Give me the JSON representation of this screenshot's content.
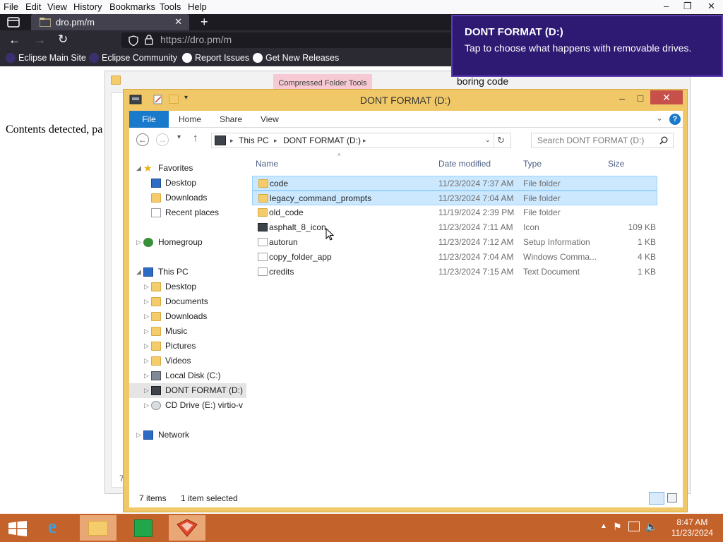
{
  "browser": {
    "menu": [
      "File",
      "Edit",
      "View",
      "History",
      "Bookmarks",
      "Tools",
      "Help"
    ],
    "tab_title": "dro.pm/m",
    "url": "https://dro.pm/m",
    "bookmarks": [
      "Eclipse Main Site",
      "Eclipse Community",
      "Report Issues",
      "Get New Releases"
    ]
  },
  "page": {
    "text": "Contents detected, pa"
  },
  "background_window": {
    "tools_tab": "Compressed Folder Tools",
    "title": "boring code",
    "left_label": "7"
  },
  "toast": {
    "title": "DONT FORMAT (D:)",
    "message": "Tap to choose what happens with removable drives."
  },
  "explorer": {
    "title": "DONT FORMAT (D:)",
    "ribbon_tabs": [
      "File",
      "Home",
      "Share",
      "View"
    ],
    "breadcrumb": [
      "This PC",
      "DONT FORMAT (D:)"
    ],
    "search_placeholder": "Search DONT FORMAT (D:)",
    "columns": [
      "Name",
      "Date modified",
      "Type",
      "Size"
    ],
    "nav": {
      "favorites": "Favorites",
      "favorites_items": [
        "Desktop",
        "Downloads",
        "Recent places"
      ],
      "homegroup": "Homegroup",
      "thispc": "This PC",
      "thispc_items": [
        "Desktop",
        "Documents",
        "Downloads",
        "Music",
        "Pictures",
        "Videos",
        "Local Disk (C:)",
        "DONT FORMAT (D:)",
        "CD Drive (E:) virtio-v"
      ],
      "network": "Network"
    },
    "files": [
      {
        "name": "code",
        "date": "11/23/2024 7:37 AM",
        "type": "File folder",
        "size": ""
      },
      {
        "name": "legacy_command_prompts",
        "date": "11/23/2024 7:04 AM",
        "type": "File folder",
        "size": ""
      },
      {
        "name": "old_code",
        "date": "11/19/2024 2:39 PM",
        "type": "File folder",
        "size": ""
      },
      {
        "name": "asphalt_8_icon",
        "date": "11/23/2024 7:11 AM",
        "type": "Icon",
        "size": "109 KB"
      },
      {
        "name": "autorun",
        "date": "11/23/2024 7:12 AM",
        "type": "Setup Information",
        "size": "1 KB"
      },
      {
        "name": "copy_folder_app",
        "date": "11/23/2024 7:04 AM",
        "type": "Windows Comma...",
        "size": "4 KB"
      },
      {
        "name": "credits",
        "date": "11/23/2024 7:15 AM",
        "type": "Text Document",
        "size": "1 KB"
      }
    ],
    "status_items": "7 items",
    "status_selected": "1 item selected"
  },
  "taskbar": {
    "time": "8:47 AM",
    "date": "11/23/2024"
  }
}
